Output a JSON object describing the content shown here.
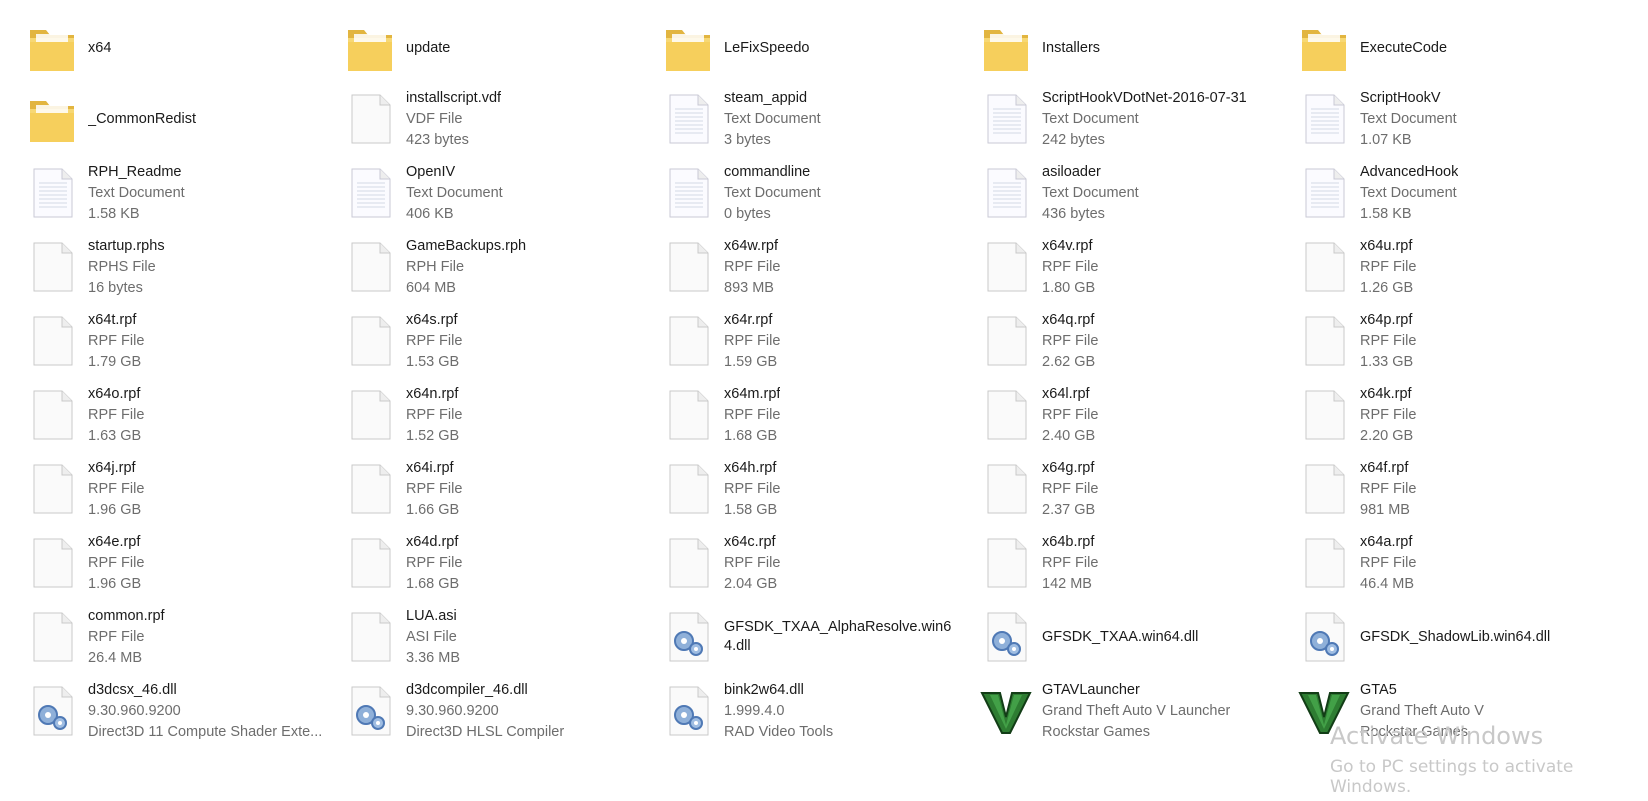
{
  "items": [
    {
      "name": "x64",
      "type": "folder"
    },
    {
      "name": "update",
      "type": "folder"
    },
    {
      "name": "LeFixSpeedo",
      "type": "folder"
    },
    {
      "name": "Installers",
      "type": "folder"
    },
    {
      "name": "ExecuteCode",
      "type": "folder"
    },
    {
      "name": "_CommonRedist",
      "type": "folder"
    },
    {
      "name": "installscript.vdf",
      "type": "doc",
      "l2": "VDF File",
      "l3": "423 bytes"
    },
    {
      "name": "steam_appid",
      "type": "text",
      "l2": "Text Document",
      "l3": "3 bytes"
    },
    {
      "name": "ScriptHookVDotNet-2016-07-31",
      "type": "text",
      "l2": "Text Document",
      "l3": "242 bytes"
    },
    {
      "name": "ScriptHookV",
      "type": "text",
      "l2": "Text Document",
      "l3": "1.07 KB"
    },
    {
      "name": "RPH_Readme",
      "type": "text",
      "l2": "Text Document",
      "l3": "1.58 KB"
    },
    {
      "name": "OpenIV",
      "type": "text",
      "l2": "Text Document",
      "l3": "406 KB"
    },
    {
      "name": "commandline",
      "type": "text",
      "l2": "Text Document",
      "l3": "0 bytes"
    },
    {
      "name": "asiloader",
      "type": "text",
      "l2": "Text Document",
      "l3": "436 bytes"
    },
    {
      "name": "AdvancedHook",
      "type": "text",
      "l2": "Text Document",
      "l3": "1.58 KB"
    },
    {
      "name": "startup.rphs",
      "type": "doc",
      "l2": "RPHS File",
      "l3": "16 bytes"
    },
    {
      "name": "GameBackups.rph",
      "type": "doc",
      "l2": "RPH File",
      "l3": "604 MB"
    },
    {
      "name": "x64w.rpf",
      "type": "doc",
      "l2": "RPF File",
      "l3": "893 MB"
    },
    {
      "name": "x64v.rpf",
      "type": "doc",
      "l2": "RPF File",
      "l3": "1.80 GB"
    },
    {
      "name": "x64u.rpf",
      "type": "doc",
      "l2": "RPF File",
      "l3": "1.26 GB"
    },
    {
      "name": "x64t.rpf",
      "type": "doc",
      "l2": "RPF File",
      "l3": "1.79 GB"
    },
    {
      "name": "x64s.rpf",
      "type": "doc",
      "l2": "RPF File",
      "l3": "1.53 GB"
    },
    {
      "name": "x64r.rpf",
      "type": "doc",
      "l2": "RPF File",
      "l3": "1.59 GB"
    },
    {
      "name": "x64q.rpf",
      "type": "doc",
      "l2": "RPF File",
      "l3": "2.62 GB"
    },
    {
      "name": "x64p.rpf",
      "type": "doc",
      "l2": "RPF File",
      "l3": "1.33 GB"
    },
    {
      "name": "x64o.rpf",
      "type": "doc",
      "l2": "RPF File",
      "l3": "1.63 GB"
    },
    {
      "name": "x64n.rpf",
      "type": "doc",
      "l2": "RPF File",
      "l3": "1.52 GB"
    },
    {
      "name": "x64m.rpf",
      "type": "doc",
      "l2": "RPF File",
      "l3": "1.68 GB"
    },
    {
      "name": "x64l.rpf",
      "type": "doc",
      "l2": "RPF File",
      "l3": "2.40 GB"
    },
    {
      "name": "x64k.rpf",
      "type": "doc",
      "l2": "RPF File",
      "l3": "2.20 GB"
    },
    {
      "name": "x64j.rpf",
      "type": "doc",
      "l2": "RPF File",
      "l3": "1.96 GB"
    },
    {
      "name": "x64i.rpf",
      "type": "doc",
      "l2": "RPF File",
      "l3": "1.66 GB"
    },
    {
      "name": "x64h.rpf",
      "type": "doc",
      "l2": "RPF File",
      "l3": "1.58 GB"
    },
    {
      "name": "x64g.rpf",
      "type": "doc",
      "l2": "RPF File",
      "l3": "2.37 GB"
    },
    {
      "name": "x64f.rpf",
      "type": "doc",
      "l2": "RPF File",
      "l3": "981 MB"
    },
    {
      "name": "x64e.rpf",
      "type": "doc",
      "l2": "RPF File",
      "l3": "1.96 GB"
    },
    {
      "name": "x64d.rpf",
      "type": "doc",
      "l2": "RPF File",
      "l3": "1.68 GB"
    },
    {
      "name": "x64c.rpf",
      "type": "doc",
      "l2": "RPF File",
      "l3": "2.04 GB"
    },
    {
      "name": "x64b.rpf",
      "type": "doc",
      "l2": "RPF File",
      "l3": "142 MB"
    },
    {
      "name": "x64a.rpf",
      "type": "doc",
      "l2": "RPF File",
      "l3": "46.4 MB"
    },
    {
      "name": "common.rpf",
      "type": "doc",
      "l2": "RPF File",
      "l3": "26.4 MB"
    },
    {
      "name": "LUA.asi",
      "type": "doc",
      "l2": "ASI File",
      "l3": "3.36 MB"
    },
    {
      "name": "GFSDK_TXAA_AlphaResolve.win64.dll",
      "type": "dll",
      "wrap": true
    },
    {
      "name": "GFSDK_TXAA.win64.dll",
      "type": "dll"
    },
    {
      "name": "GFSDK_ShadowLib.win64.dll",
      "type": "dll"
    },
    {
      "name": "d3dcsx_46.dll",
      "type": "dll",
      "l2": "9.30.960.9200",
      "l3": "Direct3D 11 Compute Shader Exte..."
    },
    {
      "name": "d3dcompiler_46.dll",
      "type": "dll",
      "l2": "9.30.960.9200",
      "l3": "Direct3D HLSL Compiler"
    },
    {
      "name": "bink2w64.dll",
      "type": "dll",
      "l2": "1.999.4.0",
      "l3": "RAD Video Tools"
    },
    {
      "name": "GTAVLauncher",
      "type": "gta",
      "l2": "Grand Theft Auto V Launcher",
      "l3": "Rockstar Games"
    },
    {
      "name": "GTA5",
      "type": "gta",
      "l2": "Grand Theft Auto V",
      "l3": "Rockstar Games"
    }
  ],
  "watermark": {
    "title": "Activate Windows",
    "subtitle": "Go to PC settings to activate Windows."
  },
  "colors": {
    "folder_light": "#f7d874",
    "folder_dark": "#e2b540",
    "text_primary": "#1a1a1a",
    "text_secondary": "#6d6d6d",
    "gta_green": "#2e7d32"
  }
}
